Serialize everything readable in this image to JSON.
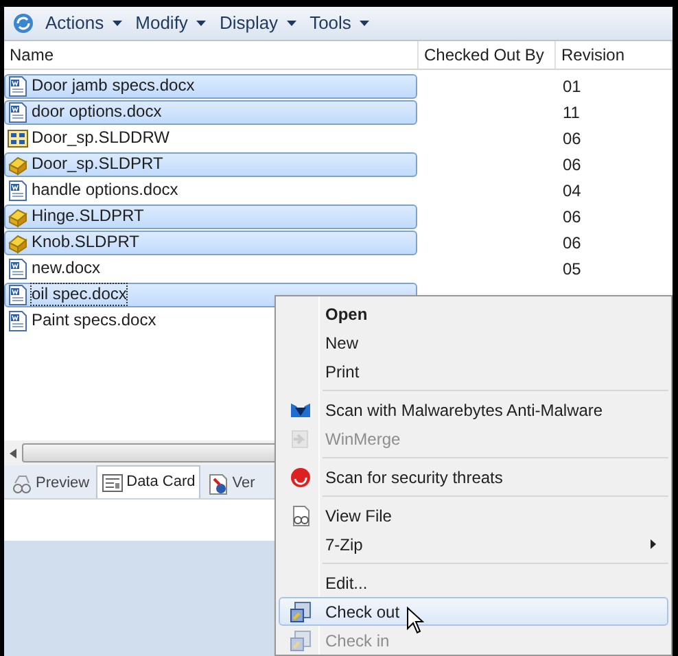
{
  "toolbar": {
    "menus": [
      {
        "label": "Actions"
      },
      {
        "label": "Modify"
      },
      {
        "label": "Display"
      },
      {
        "label": "Tools"
      }
    ]
  },
  "table": {
    "columns": [
      "Name",
      "Checked Out By",
      "Revision"
    ],
    "rows": [
      {
        "kind": "word",
        "name": "Door jamb specs.docx",
        "revision": "01",
        "selected": true,
        "focused": false
      },
      {
        "kind": "word",
        "name": "door options.docx",
        "revision": "11",
        "selected": true,
        "focused": false
      },
      {
        "kind": "drawing",
        "name": "Door_sp.SLDDRW",
        "revision": "06",
        "selected": false,
        "focused": false
      },
      {
        "kind": "part",
        "name": "Door_sp.SLDPRT",
        "revision": "06",
        "selected": true,
        "focused": false
      },
      {
        "kind": "word",
        "name": "handle options.docx",
        "revision": "04",
        "selected": false,
        "focused": false
      },
      {
        "kind": "part",
        "name": "Hinge.SLDPRT",
        "revision": "06",
        "selected": true,
        "focused": false
      },
      {
        "kind": "part",
        "name": "Knob.SLDPRT",
        "revision": "06",
        "selected": true,
        "focused": false
      },
      {
        "kind": "word",
        "name": "new.docx",
        "revision": "05",
        "selected": false,
        "focused": false
      },
      {
        "kind": "word",
        "name": "oil spec.docx",
        "selected": true,
        "focused": true
      },
      {
        "kind": "word",
        "name": "Paint specs.docx",
        "selected": false,
        "focused": false
      }
    ]
  },
  "tabs": [
    {
      "label": "Preview",
      "selected": false
    },
    {
      "label": "Data Card",
      "selected": true
    },
    {
      "label": "Ver",
      "selected": false
    }
  ],
  "context_menu": {
    "groups": [
      [
        {
          "label": "Open",
          "bold": true
        },
        {
          "label": "New"
        },
        {
          "label": "Print"
        }
      ],
      [
        {
          "label": "Scan with Malwarebytes Anti-Malware"
        },
        {
          "label": "WinMerge",
          "disabled": true
        }
      ],
      [
        {
          "label": "Scan for security threats"
        }
      ],
      [
        {
          "label": "View File"
        },
        {
          "label": "7-Zip",
          "submenu": true
        }
      ],
      [
        {
          "label": "Edit..."
        },
        {
          "label": "Check out",
          "highlighted": true
        },
        {
          "label": "Check in",
          "disabled": true
        }
      ]
    ]
  }
}
